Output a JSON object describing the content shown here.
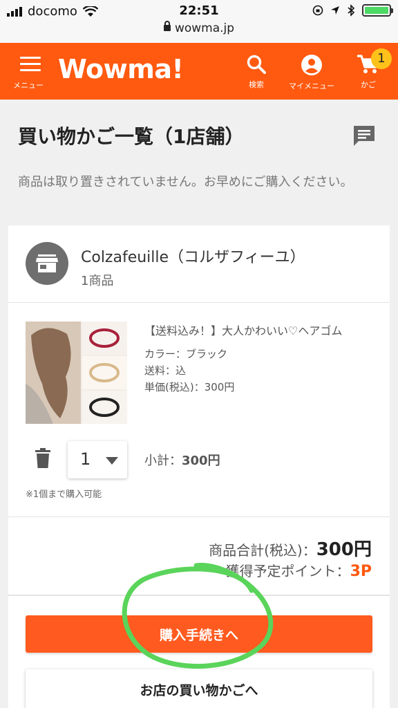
{
  "status_bar": {
    "carrier": "docomo",
    "time": "22:51",
    "url": "wowma.jp",
    "battery_color": "#4cd964",
    "battery_level": 1.0
  },
  "header": {
    "background": "#ff5a10",
    "menu_label": "メニュー",
    "logo": "Wowma!",
    "search_label": "検索",
    "mymenu_label": "マイメニュー",
    "cart_label": "かご",
    "cart_count": "1"
  },
  "page": {
    "title": "買い物かご一覧（1店舗）",
    "notice": "商品は取り置きされていません。お早めにご購入ください。"
  },
  "shop": {
    "name": "Colzafeuille（コルザフィーユ）",
    "item_count": "1商品"
  },
  "item": {
    "title": "【送料込み！】大人かわいい♡ヘアゴム",
    "color": "カラー：ブラック",
    "shipping": "送料：込",
    "unit_price": "単価(税込)：300円",
    "quantity": "1",
    "subtotal_label": "小計：",
    "subtotal_value": "300円",
    "limit_note": "※1個まで購入可能"
  },
  "totals": {
    "sum_label": "商品合計(税込)：",
    "sum_value": "300円",
    "points_label": "獲得予定ポイント：",
    "points_value": "3P",
    "accent": "#ff5a10"
  },
  "actions": {
    "checkout_label": "購入手続きへ",
    "shop_cart_label": "お店の買い物かごへ"
  },
  "annotation": {
    "circle_color": "#5ad45a"
  }
}
